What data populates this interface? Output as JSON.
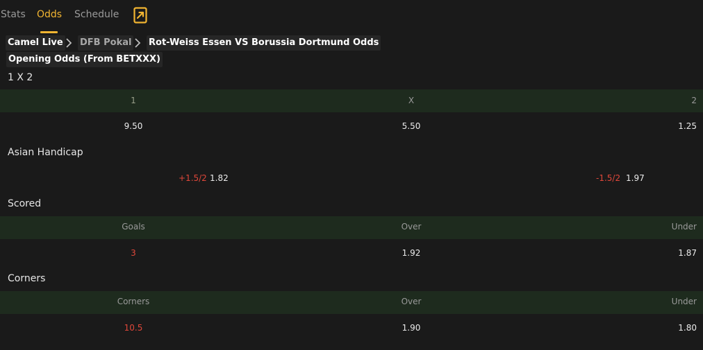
{
  "tabs": [
    {
      "label": "Stats",
      "active": false
    },
    {
      "label": "Odds",
      "active": true
    },
    {
      "label": "Schedule",
      "active": false
    }
  ],
  "share_icon": "share-arrow-icon",
  "breadcrumb": {
    "home": "Camel Live",
    "league": "DFB Pokal",
    "current": "Rot-Weiss Essen VS Borussia Dortmund Odds"
  },
  "opening_title": "Opening Odds (From BETXXX)",
  "sections": {
    "x12": {
      "title": "1 X 2",
      "headers": [
        "1",
        "X",
        "2"
      ],
      "values": [
        "9.50",
        "5.50",
        "1.25"
      ]
    },
    "asian": {
      "title": "Asian Handicap",
      "home_line": "+1.5/2",
      "home_odds": "1.82",
      "away_line": "-1.5/2",
      "away_odds": "1.97"
    },
    "scored": {
      "title": "Scored",
      "headers": [
        "Goals",
        "Over",
        "Under"
      ],
      "values": [
        "3",
        "1.92",
        "1.87"
      ]
    },
    "corners": {
      "title": "Corners",
      "headers": [
        "Corners",
        "Over",
        "Under"
      ],
      "values": [
        "10.5",
        "1.90",
        "1.80"
      ]
    }
  },
  "colors": {
    "accent": "#f2b531",
    "background": "#1a1a1a",
    "header_band": "#1e2b1e",
    "negative_red": "#e0473a"
  }
}
